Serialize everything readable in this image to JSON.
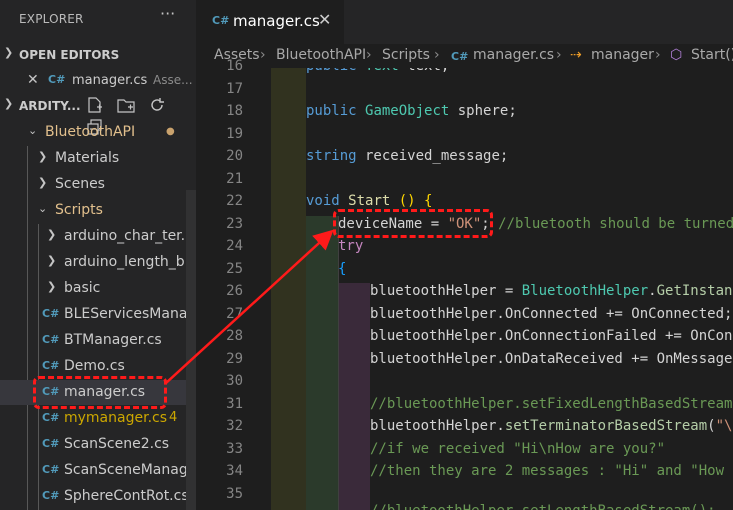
{
  "sidebar": {
    "title": "EXPLORER",
    "more_label": "···",
    "open_editors_label": "OPEN EDITORS",
    "open_editor": {
      "name": "manager.cs",
      "description": "Asse..."
    },
    "workspace_label": "ARDITY...",
    "tree": [
      {
        "name": "BluetoothAPI",
        "type": "folder",
        "expanded": true,
        "modified": true
      },
      {
        "name": "Materials",
        "type": "folder",
        "expanded": false
      },
      {
        "name": "Scenes",
        "type": "folder",
        "expanded": false
      },
      {
        "name": "Scripts",
        "type": "folder",
        "expanded": true
      },
      {
        "name": "arduino_char_ter...",
        "type": "folder",
        "expanded": false
      },
      {
        "name": "arduino_length_b...",
        "type": "folder",
        "expanded": false
      },
      {
        "name": "basic",
        "type": "folder",
        "expanded": false
      },
      {
        "name": "BLEServicesMana...",
        "type": "file"
      },
      {
        "name": "BTManager.cs",
        "type": "file"
      },
      {
        "name": "Demo.cs",
        "type": "file"
      },
      {
        "name": "manager.cs",
        "type": "file",
        "selected": true
      },
      {
        "name": "mymanager.cs",
        "type": "file",
        "badge": "4"
      },
      {
        "name": "ScanScene2.cs",
        "type": "file"
      },
      {
        "name": "ScanSceneManag...",
        "type": "file"
      },
      {
        "name": "SphereContRot.cs",
        "type": "file"
      }
    ]
  },
  "editor": {
    "tab_label": "manager.cs",
    "close_glyph": "✕",
    "breadcrumb": [
      "Assets",
      "BluetoothAPI",
      "Scripts",
      "manager.cs",
      "manager",
      "Start()"
    ],
    "line_numbers": [
      "16",
      "17",
      "18",
      "19",
      "20",
      "21",
      "22",
      "23",
      "24",
      "25",
      "26",
      "27",
      "28",
      "29",
      "30",
      "31",
      "32",
      "33",
      "34",
      "35"
    ]
  },
  "colors": {
    "annotation_red": "#ff1a1a",
    "folder_modified": "#e2c08d",
    "warning_file": "#cca700",
    "cs_icon": "#519aba"
  }
}
